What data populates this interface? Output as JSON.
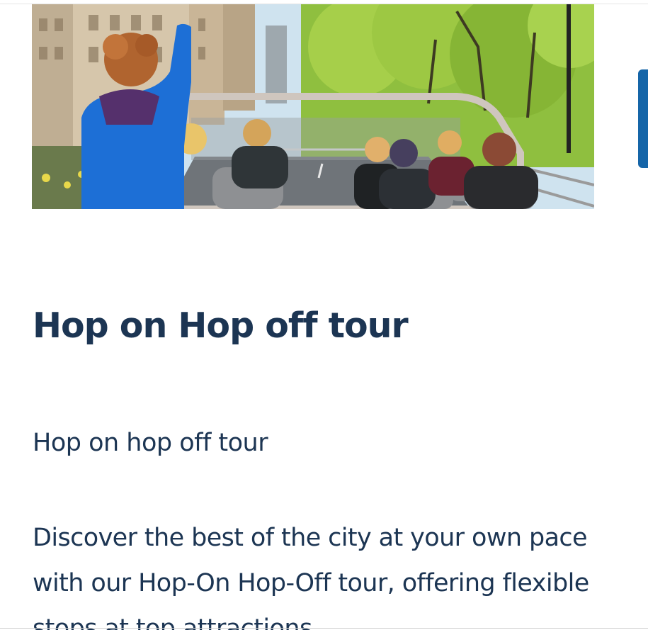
{
  "hero": {
    "image_description": "Tourists on the open top deck of a sightseeing bus riding down a tree-lined city avenue; a woman in a blue jacket points ahead"
  },
  "content": {
    "title": "Hop on Hop off tour",
    "subtitle": "Hop on hop off tour",
    "description": "Discover the best of the city at your own pace with our Hop-On Hop-Off tour, offering flexible stops at top attractions"
  },
  "colors": {
    "heading_text": "#1c3553",
    "side_tab": "#1565a8",
    "background": "#ffffff"
  }
}
